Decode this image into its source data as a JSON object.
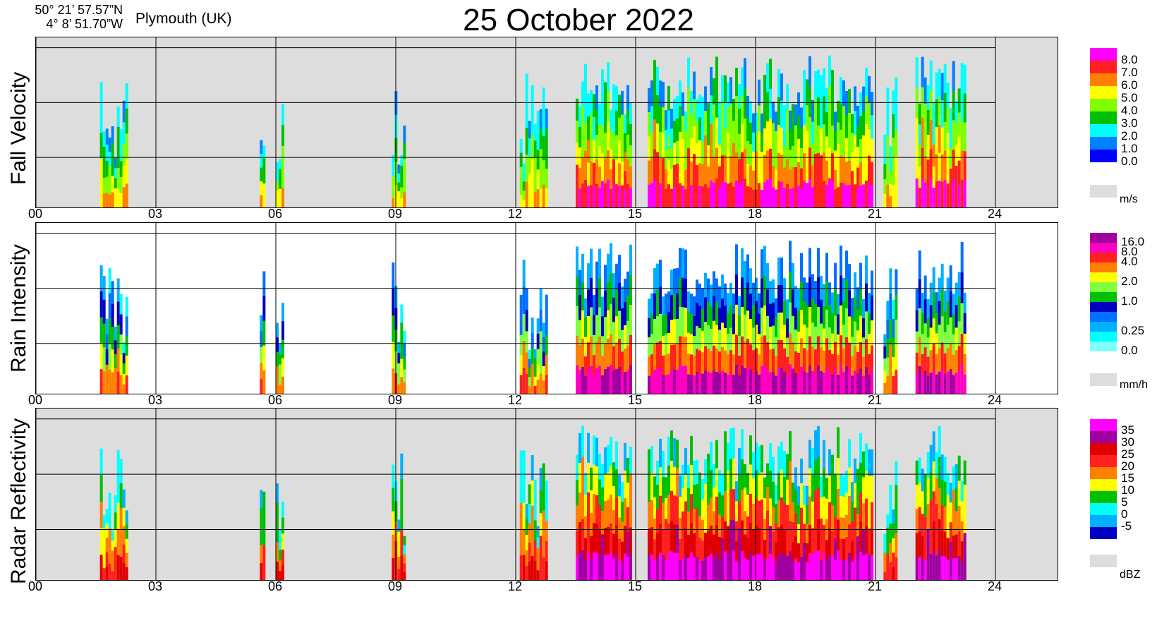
{
  "header": {
    "lat": "50° 21’ 57.57”N",
    "lon": "4°  8’ 51.70”W",
    "station": "Plymouth (UK)",
    "title": "25 October  2022"
  },
  "x_ticks": [
    "00",
    "03",
    "06",
    "09",
    "12",
    "15",
    "18",
    "21",
    "24"
  ],
  "colors": {
    "background_gray": "#dddddd",
    "grid": "#000000"
  },
  "chart_data": [
    {
      "type": "heatmap",
      "name": "Fall Velocity",
      "ylabel": "Fall Velocity",
      "xlim": [
        0,
        24
      ],
      "xticks": [
        "00",
        "03",
        "06",
        "09",
        "12",
        "15",
        "18",
        "21",
        "24"
      ],
      "background": "gray",
      "legend_unit": "m/s",
      "legend": [
        {
          "label": "8.0",
          "color": "#ff00ff"
        },
        {
          "label": "7.0",
          "color": "#ff2020"
        },
        {
          "label": "6.0",
          "color": "#ff8000"
        },
        {
          "label": "5.0",
          "color": "#ffff00"
        },
        {
          "label": "4.0",
          "color": "#80ff00"
        },
        {
          "label": "3.0",
          "color": "#00c000"
        },
        {
          "label": "2.0",
          "color": "#00ffff"
        },
        {
          "label": "1.0",
          "color": "#0080ff"
        },
        {
          "label": "0.0",
          "color": "#0000ff"
        }
      ],
      "rain_periods_hours": [
        [
          1.6,
          2.3
        ],
        [
          5.6,
          5.7
        ],
        [
          6.0,
          6.2
        ],
        [
          8.9,
          9.2
        ],
        [
          12.1,
          12.8
        ],
        [
          13.5,
          14.9
        ],
        [
          15.3,
          20.9
        ],
        [
          21.2,
          21.5
        ],
        [
          22.0,
          23.2
        ]
      ]
    },
    {
      "type": "heatmap",
      "name": "Rain Intensity",
      "ylabel": "Rain Intensity",
      "xlim": [
        0,
        24
      ],
      "xticks": [
        "00",
        "03",
        "06",
        "09",
        "12",
        "15",
        "18",
        "21",
        "24"
      ],
      "background": "white",
      "legend_unit": "mm/h",
      "legend": [
        {
          "label": "16.0",
          "color": "#a000a0"
        },
        {
          "label": "8.0",
          "color": "#ff00c0"
        },
        {
          "label": "4.0",
          "color": "#ff2020"
        },
        {
          "label": "",
          "color": "#ff8000"
        },
        {
          "label": "2.0",
          "color": "#ffff00"
        },
        {
          "label": "",
          "color": "#80ff40"
        },
        {
          "label": "1.0",
          "color": "#00c000"
        },
        {
          "label": "",
          "color": "#0000c0"
        },
        {
          "label": "",
          "color": "#0070ff"
        },
        {
          "label": "0.25",
          "color": "#00b0ff"
        },
        {
          "label": "",
          "color": "#00ffff"
        },
        {
          "label": "0.0",
          "color": "#80ffff"
        }
      ],
      "rain_periods_hours": [
        [
          1.6,
          2.3
        ],
        [
          5.6,
          5.7
        ],
        [
          6.0,
          6.2
        ],
        [
          8.9,
          9.2
        ],
        [
          12.1,
          12.8
        ],
        [
          13.5,
          14.9
        ],
        [
          15.3,
          20.9
        ],
        [
          21.2,
          21.5
        ],
        [
          22.0,
          23.2
        ]
      ]
    },
    {
      "type": "heatmap",
      "name": "Radar Reflectivity",
      "ylabel": "Radar Reflectivity",
      "xlim": [
        0,
        24
      ],
      "xticks": [
        "00",
        "03",
        "06",
        "09",
        "12",
        "15",
        "18",
        "21",
        "24"
      ],
      "background": "gray",
      "legend_unit": "dBZ",
      "legend": [
        {
          "label": "35",
          "color": "#ff00ff"
        },
        {
          "label": "30",
          "color": "#a000a0"
        },
        {
          "label": "25",
          "color": "#e00000"
        },
        {
          "label": "20",
          "color": "#ff2020"
        },
        {
          "label": "15",
          "color": "#ff8000"
        },
        {
          "label": "10",
          "color": "#ffff00"
        },
        {
          "label": "5",
          "color": "#00c000"
        },
        {
          "label": "0",
          "color": "#00ffff"
        },
        {
          "label": "-5",
          "color": "#00b0ff"
        },
        {
          "label": "",
          "color": "#0000c0"
        }
      ],
      "rain_periods_hours": [
        [
          1.6,
          2.3
        ],
        [
          5.6,
          5.7
        ],
        [
          6.0,
          6.2
        ],
        [
          8.9,
          9.2
        ],
        [
          12.1,
          12.8
        ],
        [
          13.5,
          14.9
        ],
        [
          15.3,
          20.9
        ],
        [
          21.2,
          21.5
        ],
        [
          22.0,
          23.2
        ]
      ]
    }
  ]
}
